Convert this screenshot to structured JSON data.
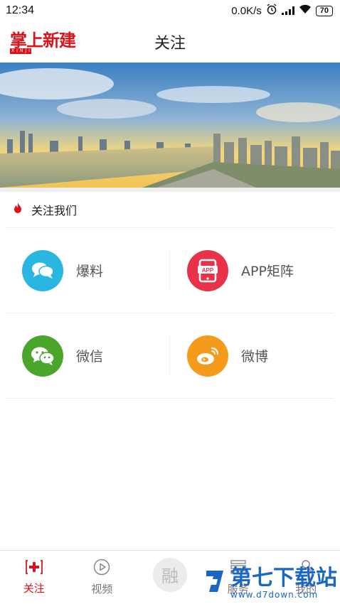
{
  "status_bar": {
    "time": "12:34",
    "speed": "0.0K/s",
    "battery": "70"
  },
  "header": {
    "logo": {
      "main": "掌上新建",
      "sub": "XINJIAN"
    },
    "title": "关注"
  },
  "banner": {
    "icon": "city-skyline-photo"
  },
  "section": {
    "title": "关注我们",
    "icon": "flame-icon"
  },
  "grid": [
    {
      "label": "爆料",
      "icon": "chat-bubbles-icon",
      "color": "#29b6e0"
    },
    {
      "label": "APP矩阵",
      "icon": "app-phone-icon",
      "color": "#e8324a"
    },
    {
      "label": "微信",
      "icon": "wechat-icon",
      "color": "#4aa52b"
    },
    {
      "label": "微博",
      "icon": "weibo-icon",
      "color": "#f59a1b"
    }
  ],
  "tabbar": {
    "tabs": [
      {
        "label": "关注",
        "icon": "plus-cross-icon"
      },
      {
        "label": "视频",
        "icon": "play-circle-icon"
      },
      {
        "label": "融",
        "icon": "rong-icon"
      },
      {
        "label": "服务",
        "icon": "list-icon"
      },
      {
        "label": "我的",
        "icon": "person-icon"
      }
    ]
  },
  "watermark": {
    "main": "第七下载站",
    "url": "www.d7down.com"
  },
  "colors": {
    "accent": "#d9141b"
  }
}
